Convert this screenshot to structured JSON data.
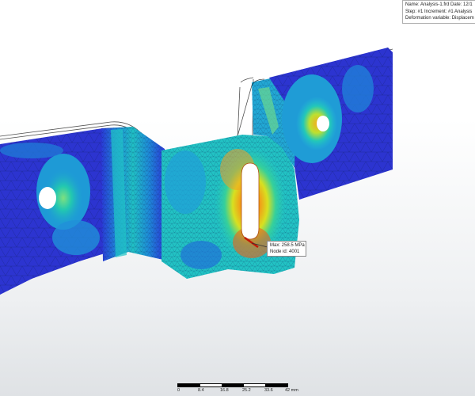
{
  "info": {
    "line1": "Name: Analysis-1.frd   Date: 12/1",
    "line2": "Step: #1   Increment: #1   Analysis",
    "line3": "Deformation variable: Displacem"
  },
  "callout": {
    "max": "Max: 258.5 MPa",
    "node": "Node id: 4001"
  },
  "scale": {
    "ticks": [
      "0",
      "8.4",
      "16.8",
      "25.2",
      "33.6",
      "42 mm"
    ]
  },
  "colors": {
    "low": "#2633d4",
    "mid": "#1fc6c6",
    "high": "#e6e01c",
    "peak": "#e53a12"
  }
}
